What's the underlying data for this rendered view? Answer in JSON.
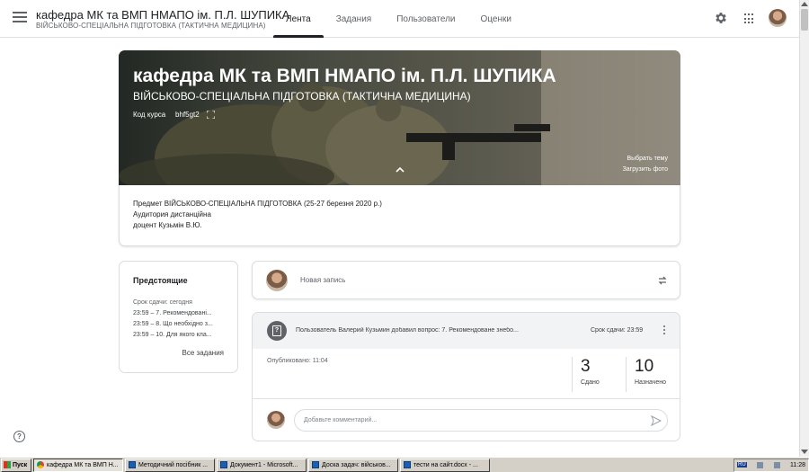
{
  "header": {
    "course_title": "кафедра МК та ВМП НМАПО ім. П.Л. ШУПИКА",
    "course_subtitle": "ВІЙСЬКОВО-СПЕЦІАЛЬНА ПІДГОТОВКА (ТАКТИЧНА МЕДИЦИНА)",
    "tabs": [
      {
        "label": "Лента",
        "active": true
      },
      {
        "label": "Задания",
        "active": false
      },
      {
        "label": "Пользователи",
        "active": false
      },
      {
        "label": "Оценки",
        "active": false
      }
    ],
    "icons": [
      "menu-icon",
      "gear-icon",
      "apps-icon",
      "avatar"
    ]
  },
  "banner": {
    "title": "кафедра МК та ВМП НМАПО ім. П.Л. ШУПИКА",
    "subtitle": "ВІЙСЬКОВО-СПЕЦІАЛЬНА ПІДГОТОВКА (ТАКТИЧНА МЕДИЦИНА)",
    "code_label": "Код курса",
    "code": "bhf5gt2",
    "select_theme": "Выбрать тему",
    "upload_photo": "Загрузить фото"
  },
  "details": {
    "subject": "Предмет ВІЙСЬКОВО-СПЕЦІАЛЬНА ПІДГОТОВКА (25-27 березня 2020 р.)",
    "room": "Аудитория дистанційна",
    "teacher": "доцент Кузьмін В.Ю."
  },
  "upcoming": {
    "title": "Предстоящие",
    "due": "Срок сдачи: сегодня",
    "items": [
      "23:59 – 7. Рекомендовані...",
      "23:59 – 8. Що необхідно з...",
      "23:59 – 10. Для якого кла..."
    ],
    "view_all": "Все задания"
  },
  "new_post": {
    "placeholder": "Новая запись"
  },
  "question_post": {
    "title": "Пользователь Валерий Кузьмин добавил вопрос: 7. Рекомендоване знебо...",
    "due": "Срок сдачи: 23:59",
    "published": "Опубликовано: 11:04",
    "stats": [
      {
        "value": "3",
        "label": "Сдано"
      },
      {
        "value": "10",
        "label": "Назначено"
      }
    ],
    "comment_placeholder": "Добавьте комментарий..."
  },
  "taskbar": {
    "start": "Пуск",
    "items": [
      {
        "label": "кафедра МК та ВМП Н...",
        "active": true,
        "icon": "chrome"
      },
      {
        "label": "Методичний посібник ...",
        "active": false,
        "icon": "doc"
      },
      {
        "label": "Документ1 - Microsoft...",
        "active": false,
        "icon": "doc"
      },
      {
        "label": "Доска задач: військов...",
        "active": false,
        "icon": "doc"
      },
      {
        "label": "тести на сайт.docx - ...",
        "active": false,
        "icon": "doc"
      }
    ],
    "lang": "RU",
    "time": "11:28"
  }
}
